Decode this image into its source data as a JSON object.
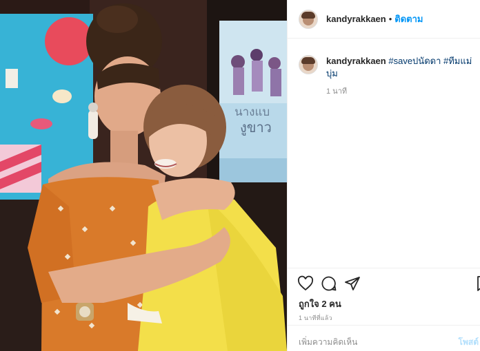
{
  "post": {
    "username": "kandyrakkaen",
    "separator": "•",
    "follow_label": "ติดตาม"
  },
  "caption": {
    "username": "kandyrakkaen",
    "hashtags": [
      "#saveปนัดดา",
      "#ทีมแม่บุ่ม"
    ],
    "time": "1 นาที"
  },
  "poster": {
    "title_line1": "นางแบ",
    "title_line2": "งูขาว"
  },
  "icons": {
    "like": "heart-icon",
    "comment": "comment-icon",
    "share": "share-icon",
    "save": "bookmark-icon"
  },
  "engagement": {
    "likes_text": "ถูกใจ 2 คน",
    "posted_time": "1 นาทีที่แล้ว"
  },
  "comment_box": {
    "placeholder": "เพิ่มความคิดเห็น",
    "post_label": "โพสต์"
  }
}
